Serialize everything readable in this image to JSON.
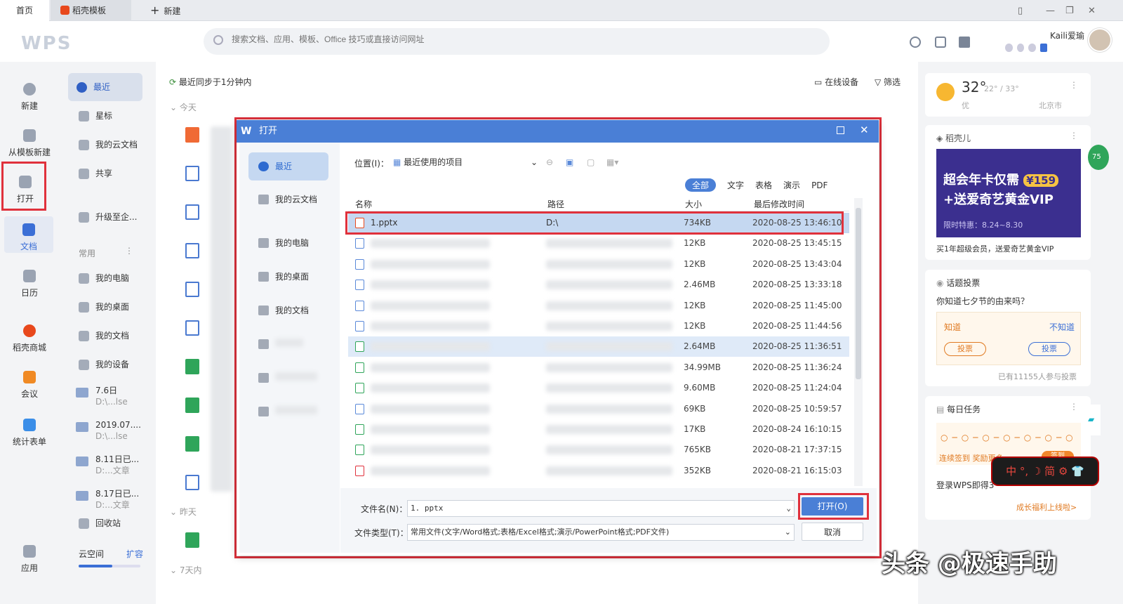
{
  "tabs": {
    "home": "首页",
    "template": "稻壳模板",
    "new": "新建"
  },
  "header": {
    "logo": "WPS",
    "search_placeholder": "搜索文档、应用、模板、Office 技巧或直接访问网址",
    "user": "Kaili爱瑜"
  },
  "leftnav": [
    "新建",
    "从模板新建",
    "打开",
    "文档",
    "日历",
    "稻壳商城",
    "会议",
    "统计表单",
    "应用"
  ],
  "sidebar": {
    "items": [
      "最近",
      "星标",
      "我的云文档",
      "共享",
      "升级至企..."
    ],
    "section": "常用",
    "places": [
      "我的电脑",
      "我的桌面",
      "我的文档",
      "我的设备"
    ],
    "recent_dirs": [
      {
        "t": "7.6日",
        "s": "D:\\...lse"
      },
      {
        "t": "2019.07....",
        "s": "D:\\...lse"
      },
      {
        "t": "8.11日已...",
        "s": "D:...文章"
      },
      {
        "t": "8.17日已...",
        "s": "D:...文章"
      }
    ],
    "recycle": "回收站",
    "cloud": "云空间",
    "expand": "扩容"
  },
  "main": {
    "sync": "最近同步于1分钟内",
    "devices": "在线设备",
    "filter": "筛选",
    "today": "今天",
    "yesterday": "昨天",
    "week": "7天内"
  },
  "weather": {
    "temp": "32°",
    "range": "22° / 33°",
    "quality": "优",
    "city": "北京市"
  },
  "docer": {
    "title": "稻壳儿",
    "banner1": "超会年卡仅需",
    "price": "¥159",
    "banner2": "+送爱奇艺黄金VIP",
    "limit": "限时特惠：8.24~8.30",
    "caption": "买1年超级会员，送爱奇艺黄金VIP",
    "badge": "75"
  },
  "vote": {
    "title": "话题投票",
    "question": "你知道七夕节的由来吗？",
    "yes": "知道",
    "no": "不知道",
    "vote_btn": "投票",
    "count": "已有11155人参与投票"
  },
  "task": {
    "title": "每日任务",
    "signin": "连续签到 奖励更多",
    "claim": "签到",
    "login": "登录WPS即得3",
    "growth": "成长福利上线啦>"
  },
  "dialog": {
    "title": "打开",
    "side": [
      "最近",
      "我的云文档",
      "我的电脑",
      "我的桌面",
      "我的文档"
    ],
    "location_label": "位置(I)：",
    "location": "最近使用的项目",
    "filter_tabs": [
      "全部",
      "文字",
      "表格",
      "演示",
      "PDF"
    ],
    "columns": [
      "名称",
      "路径",
      "大小",
      "最后修改时间"
    ],
    "rows": [
      {
        "name": "1.pptx",
        "path": "D:\\",
        "size": "734KB",
        "time": "2020-08-25 13:46:10"
      },
      {
        "name": "",
        "path": "",
        "size": "12KB",
        "time": "2020-08-25 13:45:15"
      },
      {
        "name": "",
        "path": "",
        "size": "12KB",
        "time": "2020-08-25 13:43:04"
      },
      {
        "name": "",
        "path": "",
        "size": "2.46MB",
        "time": "2020-08-25 13:33:18"
      },
      {
        "name": "",
        "path": "",
        "size": "12KB",
        "time": "2020-08-25 11:45:00"
      },
      {
        "name": "",
        "path": "",
        "size": "12KB",
        "time": "2020-08-25 11:44:56"
      },
      {
        "name": "",
        "path": "",
        "size": "2.64MB",
        "time": "2020-08-25 11:36:51"
      },
      {
        "name": "",
        "path": "",
        "size": "34.99MB",
        "time": "2020-08-25 11:36:24"
      },
      {
        "name": "",
        "path": "",
        "size": "9.60MB",
        "time": "2020-08-25 11:24:04"
      },
      {
        "name": "",
        "path": "",
        "size": "69KB",
        "time": "2020-08-25 10:59:57"
      },
      {
        "name": "",
        "path": "",
        "size": "17KB",
        "time": "2020-08-24 16:10:15"
      },
      {
        "name": "",
        "path": "",
        "size": "765KB",
        "time": "2020-08-21 17:37:15"
      },
      {
        "name": "",
        "path": "",
        "size": "352KB",
        "time": "2020-08-21 16:15:03"
      }
    ],
    "filename_label": "文件名(N)：",
    "filename": "1. pptx",
    "filetype_label": "文件类型(T)：",
    "filetype": "常用文件(文字/Word格式;表格/Excel格式;演示/PowerPoint格式;PDF文件)",
    "open": "打开(O)",
    "cancel": "取消"
  },
  "ime": "中 °, ☽ 简 ⚙ 👕",
  "watermark": "头条 @极速手助",
  "colors": {
    "accent": "#4a7fd6",
    "highlight": "#e0313c"
  }
}
